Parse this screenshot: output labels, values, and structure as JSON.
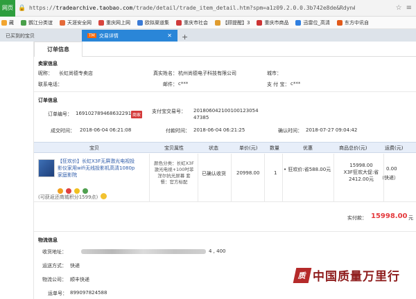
{
  "browser": {
    "badge": "网页",
    "url_prefix": "https://",
    "url_host": "tradearchive.taobao.com",
    "url_path": "/trade/detail/trade_item_detail.htm?spm=a1z09.2.0.0.3b742e8de&Rdyn#biz0rc",
    "colors": {
      "accent": "#2a86d8",
      "badge_green": "#2e9e3e"
    }
  },
  "bookmarks": [
    {
      "label": "藏",
      "color": "#f2a52f"
    },
    {
      "label": "鹦江分类谊",
      "color": "#4aa04a"
    },
    {
      "label": "天涯安全网",
      "color": "#e56b3a"
    },
    {
      "label": "重庆网上网",
      "color": "#d8453e"
    },
    {
      "label": "欧拟渠道集",
      "color": "#3b7bd6"
    },
    {
      "label": "重庆市社会",
      "color": "#cf3b3b"
    },
    {
      "label": "【顾提醒】3",
      "color": "#e09c2e"
    },
    {
      "label": "重庆市商品",
      "color": "#c33"
    },
    {
      "label": "迅雷位_高清",
      "color": "#2f7fe0"
    },
    {
      "label": "东方中讯自",
      "color": "#e25a1a"
    }
  ],
  "tabs": [
    {
      "label": "已买到的宝贝",
      "active": false
    },
    {
      "label": "交易详情",
      "active": true,
      "icon_text": "TM"
    }
  ],
  "order": {
    "tab_title": "订单信息",
    "seller_section": "卖家信息",
    "nickname_label": "昵称：",
    "nickname_value": "长虹尚德专卖店",
    "realname_label": "真实姓名：",
    "realname_value": "杭州尚德电子科技有限公司",
    "city_label": "城市：",
    "phone_label": "联系电话：",
    "email_label": "邮件：",
    "email_value": "c***",
    "alipay_label": "支 付 宝：",
    "alipay_value": "c***",
    "order_section": "订单信息",
    "order_no_label": "订单编号：",
    "order_no_value": "169102789468632291",
    "order_no_badge": "商家",
    "alipay_trade_label": "支付宝交易号：",
    "alipay_trade_value_1": "201806042100100123054",
    "alipay_trade_value_2": "47385",
    "deal_time_label": "成交时间：",
    "deal_time_value": "2018-06-04 06:21:08",
    "pay_time_label": "付款时间：",
    "pay_time_value": "2018-06-04 06:21:25",
    "confirm_time_label": "确认时间：",
    "confirm_time_value": "2018-07-27 09:04:42"
  },
  "table": {
    "headers": [
      "宝贝",
      "宝贝属性",
      "状态",
      "单价(元)",
      "数量",
      "优惠",
      "商品总价(元)",
      "运费(元)"
    ],
    "product_title": "【狂欢价】长虹X3F无屏激光电视投影仪家用wifi无线投影机高清1080p家庭影院",
    "product_attr": "颜色分类：长虹X3F激光电视+100吋菲涅尔抗光屏幕 套餐：官方标配",
    "status": "已确认收货",
    "unit_price": "20998.00",
    "quantity": "1",
    "discount": "• 狂欢价:省588.00元",
    "total_1": "15998.00",
    "total_2": "X3F狂欢大促:省2412.00元",
    "shipping_1": "0.00",
    "shipping_2": "（快递）",
    "icon_colors": [
      "#f0a020",
      "#e04040",
      "#f0c020",
      "#50a050"
    ]
  },
  "points_note": "(可获返还商城积分1599点)",
  "paid_label": "实付款：",
  "paid_value": "15998.00",
  "paid_unit": "元",
  "logistics": {
    "section": "物流信息",
    "addr_label": "收货地址：",
    "addr_tail": "4 , 400",
    "method_label": "运送方式：",
    "method_value": "快递",
    "company_label": "物流公司：",
    "company_value": "顺丰快递",
    "waybill_label": "运单号：",
    "waybill_value": "899097824588"
  },
  "watermark": {
    "text": "中国质量万里行",
    "logo": "质"
  }
}
